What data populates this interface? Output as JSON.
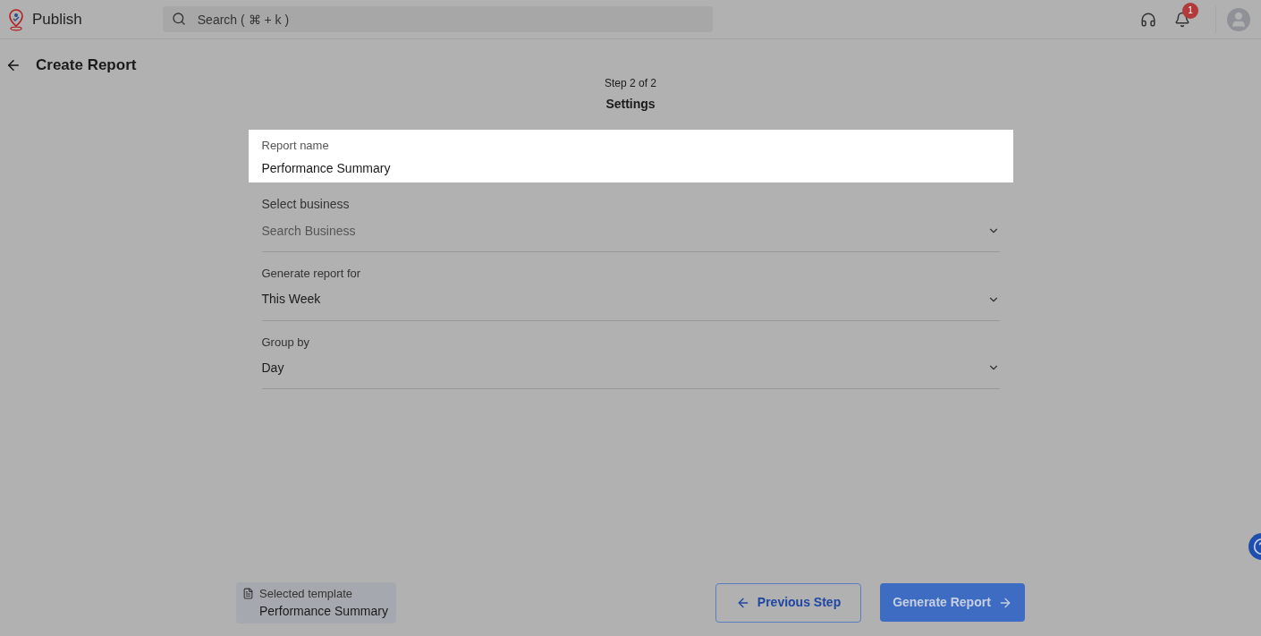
{
  "header": {
    "app_name": "Publish",
    "search": {
      "placeholder": "Search ( ⌘ + k )"
    },
    "notification_count": "1"
  },
  "page": {
    "title": "Create Report",
    "step": "Step 2 of 2",
    "step_title": "Settings"
  },
  "fields": [
    {
      "kind": "text",
      "label": "Report name",
      "value": "Performance Summary",
      "highlighted": true
    },
    {
      "kind": "select",
      "label": "Select business",
      "placeholder": "Search Business",
      "highlighted": false
    },
    {
      "kind": "select",
      "label": "Generate report for",
      "value": "This Week",
      "highlighted": false
    },
    {
      "kind": "select",
      "label": "Group by",
      "value": "Day",
      "highlighted": false
    }
  ],
  "template": {
    "label": "Selected template",
    "name": "Performance Summary"
  },
  "buttons": {
    "previous": "Previous Step",
    "generate": "Generate Report"
  }
}
